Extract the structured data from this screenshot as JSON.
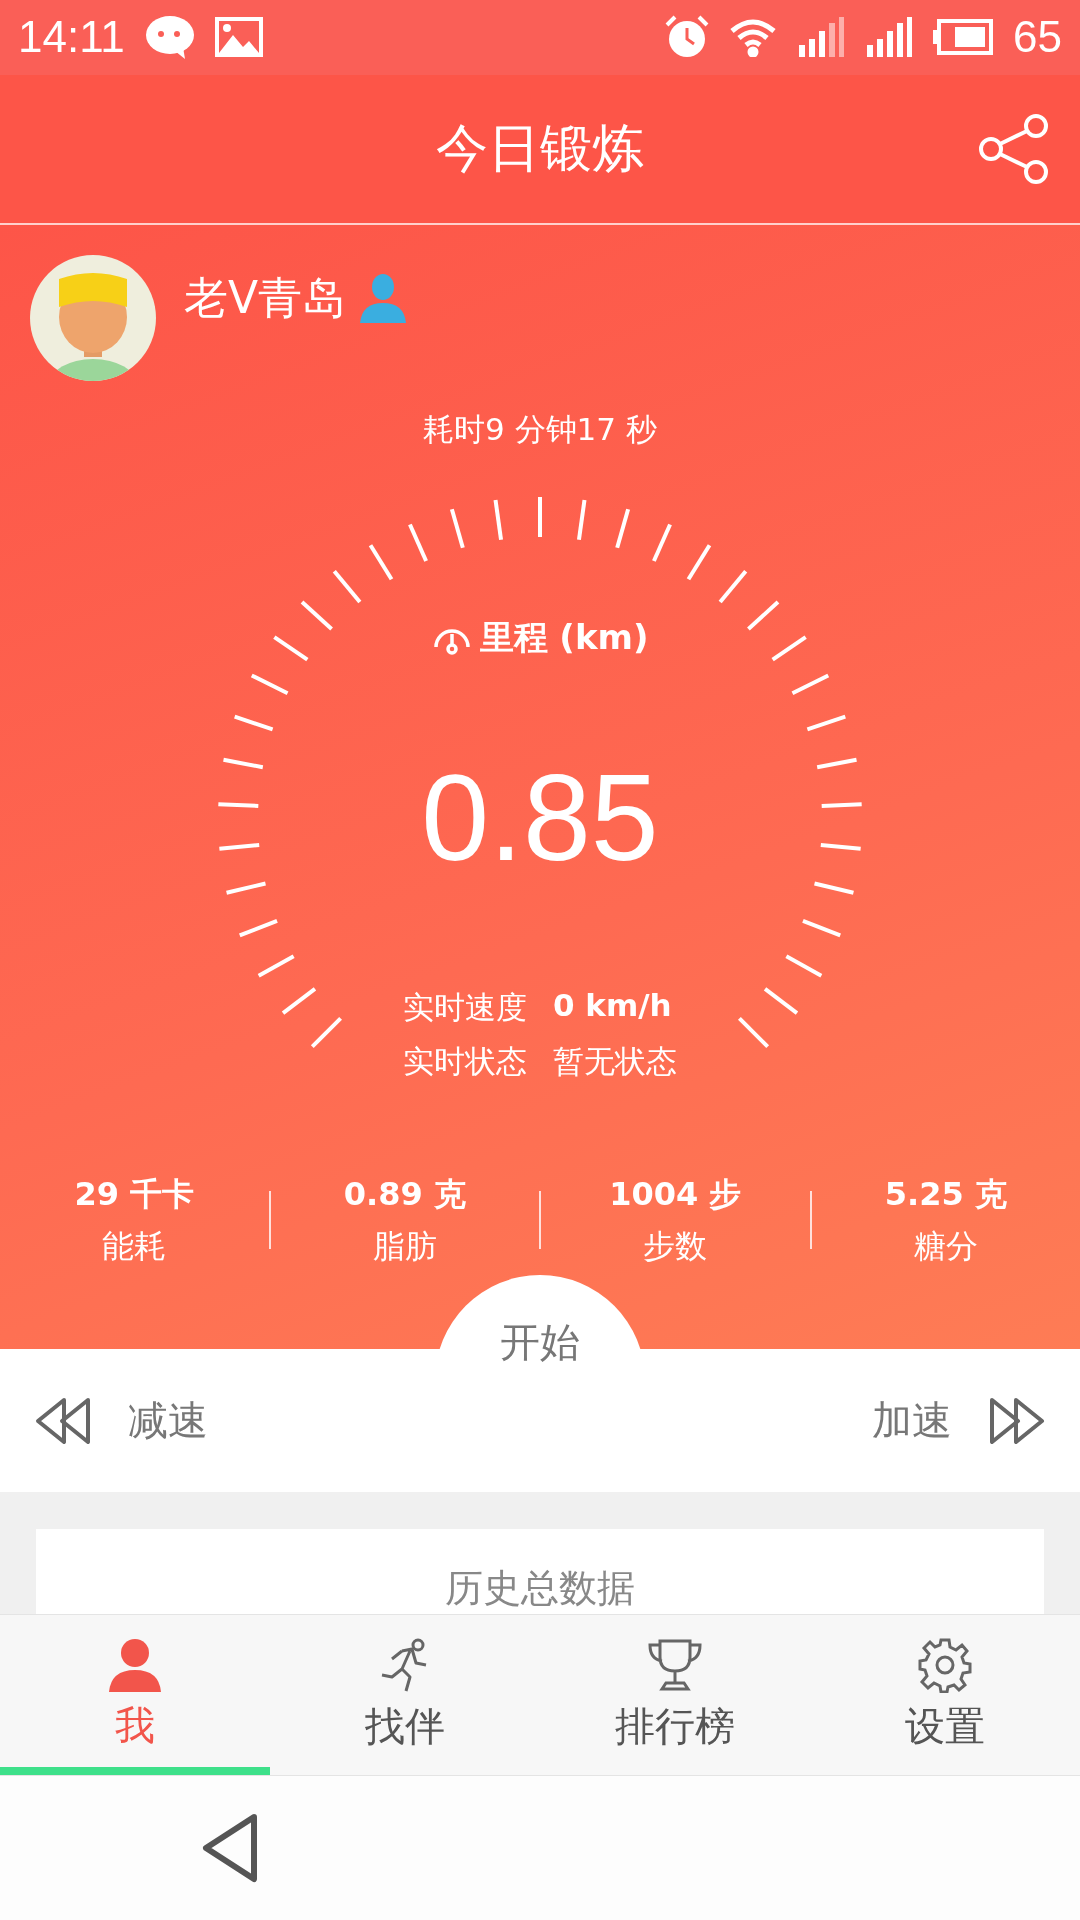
{
  "status_bar": {
    "time": "14:11",
    "battery": "65"
  },
  "header": {
    "title": "今日锻炼"
  },
  "user": {
    "name": "老V青岛"
  },
  "workout": {
    "duration": "耗时9 分钟17 秒",
    "metric_label": "里程 (km)",
    "distance": "0.85",
    "speed_label": "实时速度",
    "speed_value": "0 km/h",
    "state_label": "实时状态",
    "state_value": "暂无状态"
  },
  "stats": [
    {
      "value": "29 千卡",
      "label": "能耗"
    },
    {
      "value": "0.89 克",
      "label": "脂肪"
    },
    {
      "value": "1004 步",
      "label": "步数"
    },
    {
      "value": "5.25 克",
      "label": "糖分"
    }
  ],
  "controls": {
    "slower": "减速",
    "start": "开始",
    "faster": "加速"
  },
  "history": {
    "title": "历史总数据"
  },
  "tabs": [
    {
      "label": "我",
      "kind": "person",
      "selected": true
    },
    {
      "label": "找伴",
      "kind": "runner",
      "selected": false
    },
    {
      "label": "排行榜",
      "kind": "trophy",
      "selected": false
    },
    {
      "label": "设置",
      "kind": "gear",
      "selected": false
    }
  ]
}
